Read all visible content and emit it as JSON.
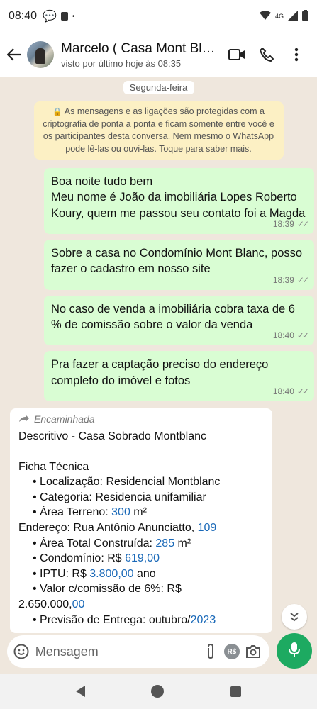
{
  "status_bar": {
    "time": "08:40",
    "network": "4G"
  },
  "header": {
    "contact_name": "Marcelo ( Casa Mont Bla...",
    "last_seen": "visto por último hoje às 08:35"
  },
  "chat": {
    "day_label": "Segunda-feira",
    "encryption_notice": "As mensagens e as ligações são protegidas com a criptografia de ponta a ponta e ficam somente entre você e os participantes desta conversa. Nem mesmo o WhatsApp pode lê-las ou ouvi-las. Toque para saber mais.",
    "outgoing": [
      {
        "text": "Boa noite tudo bem\nMeu nome é João da imobiliária Lopes Roberto Koury, quem me passou seu contato foi a Magda",
        "time": "18:39"
      },
      {
        "text": "Sobre a casa no Condomínio Mont Blanc, posso fazer o cadastro em nosso site",
        "time": "18:39"
      },
      {
        "text": "No caso de venda a imobiliária cobra taxa de 6 % de comissão sobre o valor da venda",
        "time": "18:40"
      },
      {
        "text": "Pra fazer a captação preciso do endereço completo do imóvel e fotos",
        "time": "18:40"
      }
    ],
    "incoming": {
      "forwarded_label": "Encaminhada",
      "title": "Descritivo - Casa Sobrado Montblanc",
      "ficha_heading": "Ficha Técnica",
      "localizacao": "• Localização: Residencial Montblanc",
      "categoria": "• Categoria: Residencia unifamiliar",
      "area_terreno_prefix": "• Área Terreno: ",
      "area_terreno_value": "300",
      "area_terreno_suffix": " m²",
      "endereco_prefix": "Endereço: Rua Antônio Anunciatto, ",
      "endereco_number": "109",
      "area_construida_prefix": "• Área Total Construída: ",
      "area_construida_value": "285",
      "area_construida_suffix": " m²",
      "condominio_prefix": "• Condomínio: R$ ",
      "condominio_value": "619,00",
      "iptu_prefix": "• IPTU: R$ ",
      "iptu_value": "3.800,00",
      "iptu_suffix": " ano",
      "valor_label": "• Valor c/comissão de 6%: R$",
      "valor_prefix": "2.650.000,",
      "valor_cents": "00",
      "previsao_prefix": "• Previsão de Entrega: outubro/",
      "previsao_year": "2023"
    }
  },
  "composer": {
    "placeholder": "Mensagem",
    "currency_label": "R$"
  },
  "colors": {
    "outgoing_bubble": "#d9fdd3",
    "incoming_bubble": "#ffffff",
    "mic_button": "#1daa61",
    "link_blue": "#1a69b8",
    "encryption_note_bg": "#fcf0c4"
  }
}
